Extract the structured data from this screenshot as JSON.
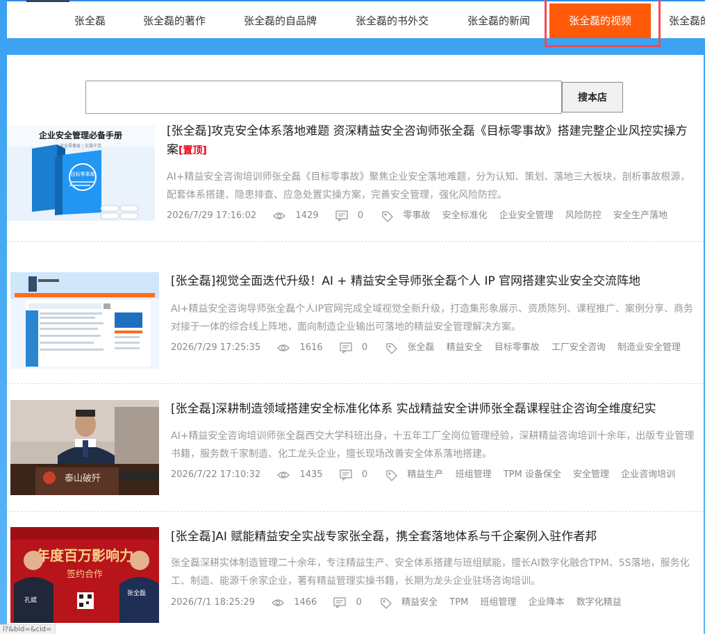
{
  "nav": {
    "items": [
      {
        "label": "张全磊"
      },
      {
        "label": "张全磊的著作"
      },
      {
        "label": "张全磊的自品牌"
      },
      {
        "label": "张全磊的书外交"
      },
      {
        "label": "张全磊的新闻"
      },
      {
        "label": "张全磊的视频"
      },
      {
        "label": "张全磊的"
      }
    ],
    "active_index": 5,
    "active_bg": "#ff5a0a"
  },
  "search": {
    "value": "",
    "placeholder": "",
    "button_label": "搜本店"
  },
  "articles": [
    {
      "title": "[张全磊]攻克安全体系落地难题 资深精益安全咨询师张全磊《目标零事故》搭建完整企业风控实操方案",
      "badge": "[置顶]",
      "desc": "AI+精益安全咨询培训师张全磊《目标零事故》聚焦企业安全落地难题，分为认知、策划、落地三大板块，剖析事故根源，配套体系搭建、隐患排查、应急处置实操方案，完善安全管理，强化风险防控。",
      "date": "2026/7/29 17:16:02",
      "views": "1429",
      "comments": "0",
      "tags": [
        "零事故",
        "安全标准化",
        "企业安全管理",
        "风险防控",
        "安全生产落地"
      ],
      "thumb": {
        "heading": "企业安全管理必备手册",
        "sub": "安全零事故丨实操干货",
        "book": "目标零事故"
      }
    },
    {
      "title": "[张全磊]视觉全面迭代升级！AI + 精益安全导师张全磊个人 IP 官网搭建实业安全交流阵地",
      "desc": "AI+精益安全咨询导师张全磊个人IP官网完成全域视觉全新升级，打造集形象展示、资质陈列、课程推广、案例分享、商务对接于一体的综合线上阵地，面向制造企业输出可落地的精益安全管理解决方案。",
      "date": "2026/7/29 17:25:35",
      "views": "1616",
      "comments": "0",
      "tags": [
        "张全磊",
        "精益安全",
        "目标零事故",
        "工厂安全咨询",
        "制造业安全管理"
      ]
    },
    {
      "title": "[张全磊]深耕制造领域搭建安全标准化体系 实战精益安全讲师张全磊课程驻企咨询全维度纪实",
      "desc": "AI+精益安全咨询培训师张全磊西交大学科班出身，十五年工厂全岗位管理经验，深耕精益咨询培训十余年，出版专业管理书籍，服务数千家制造、化工龙头企业，擅长现场改善安全体系落地搭建。",
      "date": "2026/7/22 17:10:32",
      "views": "1435",
      "comments": "0",
      "tags": [
        "精益生产",
        "班组管理",
        "TPM 设备保全",
        "安全管理",
        "企业咨询培训"
      ],
      "thumb": {
        "podium": "泰山破歼"
      }
    },
    {
      "title": "[张全磊]AI 赋能精益安全实战专家张全磊，携全套落地体系与千企案例入驻作者邦",
      "desc": "张全磊深耕实体制造管理二十余年，专注精益生产、安全体系搭建与班组赋能，擅长AI数字化融合TPM、5S落地，服务化工、制造、能源千余家企业，著有精益管理实操书籍，长期为龙头企业驻场咨询培训。",
      "date": "2026/7/1 18:25:29",
      "views": "1466",
      "comments": "0",
      "tags": [
        "精益安全",
        "TPM",
        "班组管理",
        "企业降本",
        "数字化精益"
      ],
      "thumb": {
        "headline": "年度百万影响力",
        "sub": "签约合作",
        "left_name": "孔斌",
        "right_name": "张全磊"
      }
    }
  ],
  "status_url": "l?&bid=&cid="
}
